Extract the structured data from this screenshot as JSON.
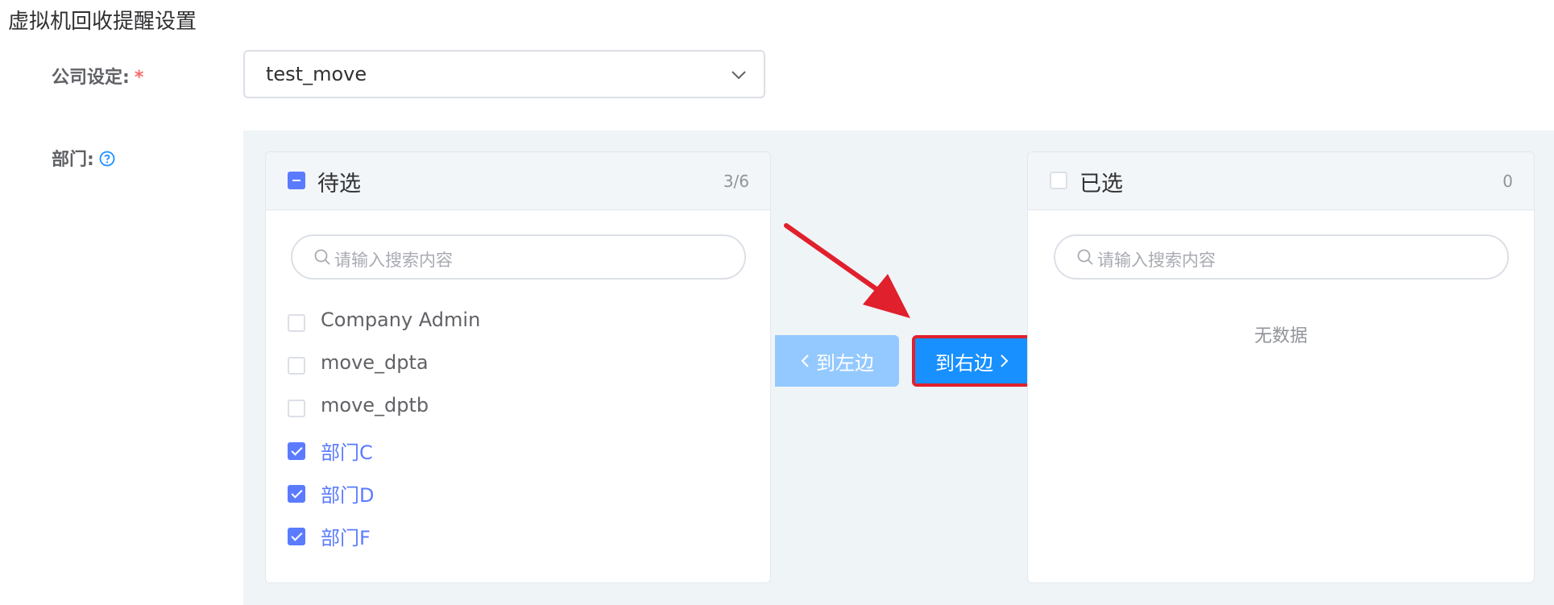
{
  "page": {
    "title": "虚拟机回收提醒设置"
  },
  "form": {
    "company_label": "公司设定",
    "company_colon": ":",
    "required_mark": "*",
    "company_value": "test_move",
    "department_label": "部门",
    "department_colon": ":"
  },
  "transfer": {
    "left": {
      "title": "待选",
      "count": "3/6",
      "search_placeholder": "请输入搜索内容",
      "items": [
        {
          "label": "Company Admin",
          "checked": false
        },
        {
          "label": "move_dpta",
          "checked": false
        },
        {
          "label": "move_dptb",
          "checked": false
        },
        {
          "label": "部门C",
          "checked": true
        },
        {
          "label": "部门D",
          "checked": true
        },
        {
          "label": "部门F",
          "checked": true
        }
      ]
    },
    "right": {
      "title": "已选",
      "count": "0",
      "search_placeholder": "请输入搜索内容",
      "empty_text": "无数据"
    },
    "to_left_label": "到左边",
    "to_right_label": "到右边"
  },
  "icons": {
    "help": "question-circle-icon",
    "dropdown": "chevron-down-icon",
    "search": "search-icon",
    "left_arrow": "chevron-left-icon",
    "right_arrow": "chevron-right-icon"
  },
  "colors": {
    "primary": "#1890ff",
    "primary_light": "#94c9ff",
    "checkbox_accent": "#5b7bff",
    "required": "#f56c6c",
    "annotation": "#e0202c",
    "panel_bg": "#eff4f7"
  }
}
